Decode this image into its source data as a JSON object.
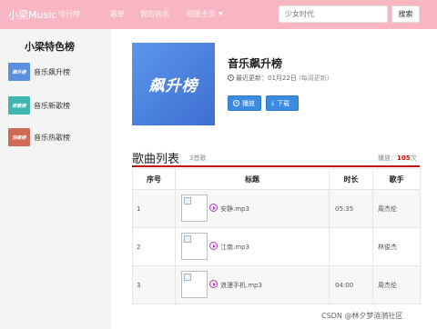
{
  "nav": {
    "brand": "小梁Music",
    "items": [
      "排行榜",
      "歌单",
      "我的音乐",
      "相册主页"
    ],
    "search_placeholder": "少女时代",
    "search_button": "搜索"
  },
  "sidebar": {
    "title": "小梁特色榜",
    "items": [
      {
        "label": "音乐飙升榜",
        "thumb_text": "飙升榜",
        "color": "#5b8fe0"
      },
      {
        "label": "音乐新歌榜",
        "thumb_text": "新歌榜",
        "color": "#3fb6b0"
      },
      {
        "label": "音乐热歌榜",
        "thumb_text": "热歌榜",
        "color": "#d06a55"
      }
    ]
  },
  "playlist": {
    "cover_text": "飙升榜",
    "title": "音乐飙升榜",
    "updated_label": "最近更新：",
    "updated_date": "01月22日",
    "update_note": "(每周更新)",
    "play_button": "播放",
    "download_button": "下载"
  },
  "songs": {
    "heading": "歌曲列表",
    "count": "3首歌",
    "plays_label": "播放：",
    "plays_value": "105",
    "plays_unit": "次",
    "columns": [
      "序号",
      "标题",
      "时长",
      "歌手"
    ],
    "rows": [
      {
        "index": "1",
        "title": "安静.mp3",
        "duration": "05:35",
        "artist": "周杰伦"
      },
      {
        "index": "2",
        "title": "江南.mp3",
        "duration": "",
        "artist": "林俊杰"
      },
      {
        "index": "3",
        "title": "浪漫手机.mp3",
        "duration": "04:00",
        "artist": "周杰伦"
      }
    ]
  },
  "watermark": "CSDN @林夕梦涟漪社区",
  "colors": {
    "nav_bg": "#f8b6c2",
    "accent_red": "#c20c0c",
    "button_blue": "#3d8be0"
  }
}
